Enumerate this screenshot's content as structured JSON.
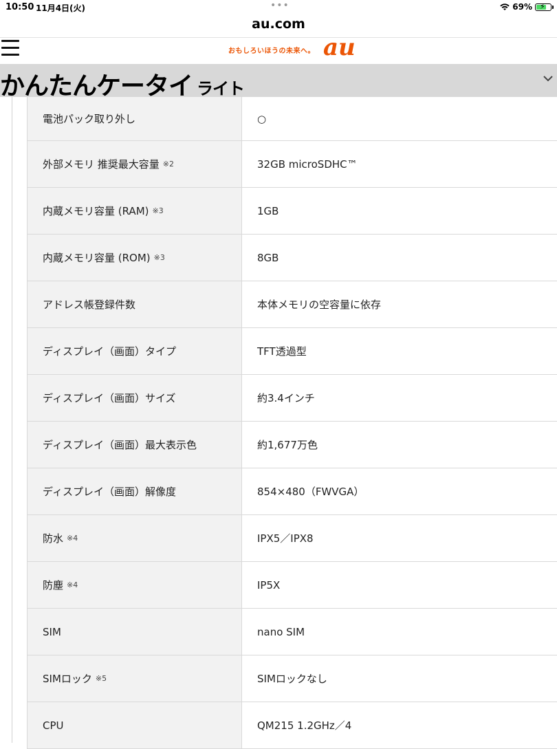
{
  "status_bar": {
    "time": "10:50",
    "date": "11月4日(火)",
    "dots": "•••",
    "battery": "69%"
  },
  "address_bar": {
    "url": "au.com"
  },
  "site_header": {
    "tagline": "おもしろいほうの未来へ。",
    "logo_text": "au",
    "brand_color": "#eb5505"
  },
  "product": {
    "title_main": "かんたんケータイ",
    "title_sub": "ライト"
  },
  "specs": [
    {
      "label": "電池パック取り外し",
      "note": "",
      "value": "○"
    },
    {
      "label": "外部メモリ 推奨最大容量",
      "note": "※2",
      "value": "32GB microSDHC™"
    },
    {
      "label": "内蔵メモリ容量 (RAM)",
      "note": "※3",
      "value": "1GB"
    },
    {
      "label": "内蔵メモリ容量 (ROM)",
      "note": "※3",
      "value": "8GB"
    },
    {
      "label": "アドレス帳登録件数",
      "note": "",
      "value": "本体メモリの空容量に依存"
    },
    {
      "label": "ディスプレイ（画面）タイプ",
      "note": "",
      "value": "TFT透過型"
    },
    {
      "label": "ディスプレイ（画面）サイズ",
      "note": "",
      "value": "約3.4インチ"
    },
    {
      "label": "ディスプレイ（画面）最大表示色",
      "note": "",
      "value": "約1,677万色"
    },
    {
      "label": "ディスプレイ（画面）解像度",
      "note": "",
      "value": "854×480（FWVGA）"
    },
    {
      "label": "防水",
      "note": "※4",
      "value": "IPX5／IPX8"
    },
    {
      "label": "防塵",
      "note": "※4",
      "value": "IP5X"
    },
    {
      "label": "SIM",
      "note": "",
      "value": "nano SIM"
    },
    {
      "label": "SIMロック",
      "note": "※5",
      "value": "SIMロックなし"
    },
    {
      "label": "CPU",
      "note": "",
      "value": "QM215 1.2GHz／4"
    }
  ]
}
